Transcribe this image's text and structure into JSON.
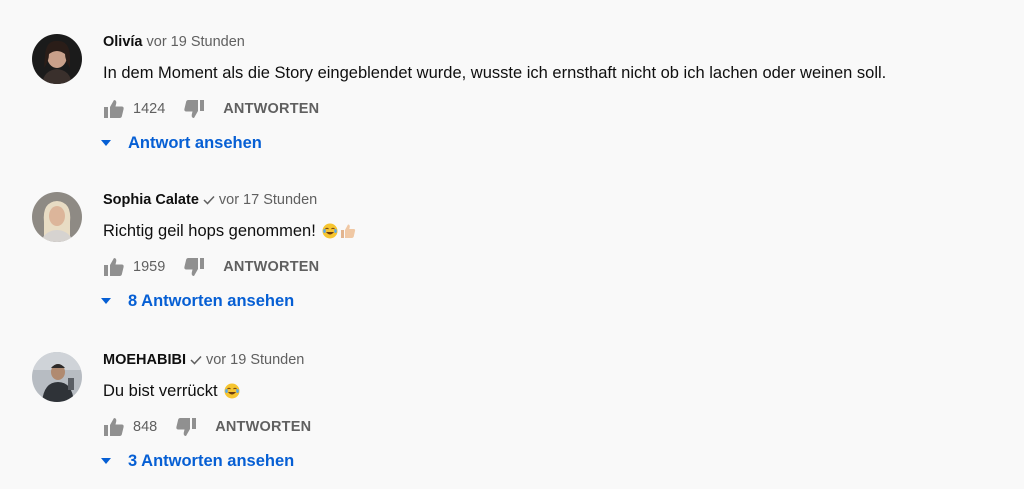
{
  "comments": [
    {
      "author": "Olivía",
      "verified": false,
      "time": "vor 19 Stunden",
      "text": "In dem Moment als die Story eingeblendet wurde, wusste ich ernsthaft nicht ob ich lachen oder weinen soll.",
      "emojis": [],
      "likes": "1424",
      "reply_label": "ANTWORTEN",
      "replies_label": "Antwort ansehen"
    },
    {
      "author": "Sophia Calate",
      "verified": true,
      "time": "vor 17 Stunden",
      "text": "Richtig geil hops genommen!",
      "emojis": [
        "face-with-tears-of-joy",
        "thumbs-up"
      ],
      "likes": "1959",
      "reply_label": "ANTWORTEN",
      "replies_label": "8 Antworten ansehen"
    },
    {
      "author": "MOEHABIBI",
      "verified": true,
      "time": "vor 19 Stunden",
      "text": "Du bist verrückt",
      "emojis": [
        "face-with-tears-of-joy"
      ],
      "likes": "848",
      "reply_label": "ANTWORTEN",
      "replies_label": "3 Antworten ansehen"
    }
  ],
  "icons": {
    "like": "thumbs-up-icon",
    "dislike": "thumbs-down-icon",
    "expand": "caret-down-icon",
    "verified": "checkmark-icon"
  },
  "colors": {
    "background": "#f9f9f9",
    "link_blue": "#065fd4",
    "secondary_text": "#606060",
    "primary_text": "#0f0f0f"
  }
}
